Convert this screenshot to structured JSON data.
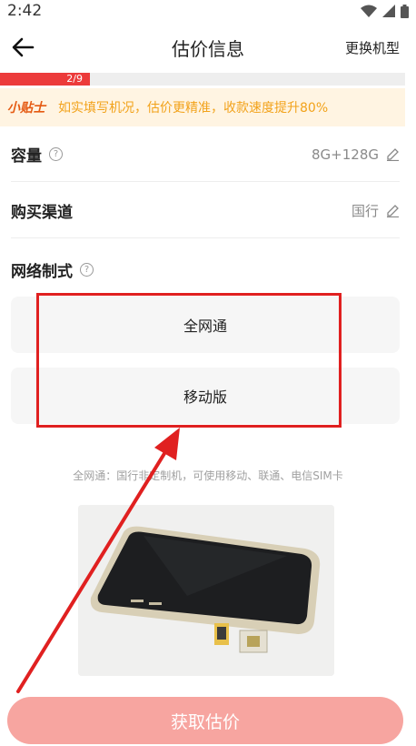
{
  "status": {
    "time": "2:42"
  },
  "header": {
    "title": "估价信息",
    "switch_model": "更换机型"
  },
  "progress": {
    "label": "2/9",
    "current": 2,
    "total": 9
  },
  "tip": {
    "tag": "小贴士",
    "text": "如实填写机况，估价更精准，收款速度提升80%"
  },
  "fields": {
    "capacity": {
      "label": "容量",
      "value": "8G+128G"
    },
    "channel": {
      "label": "购买渠道",
      "value": "国行"
    }
  },
  "network": {
    "label": "网络制式",
    "options": [
      "全网通",
      "移动版"
    ],
    "description": "全网通：国行非定制机，可使用移动、联通、电信SIM卡"
  },
  "cta": {
    "label": "获取估价"
  },
  "colors": {
    "accent": "#ec3b3b",
    "cta_bg": "#f7a5a0",
    "tip_bg": "#fff4e2",
    "tip_text": "#f2a21a"
  }
}
